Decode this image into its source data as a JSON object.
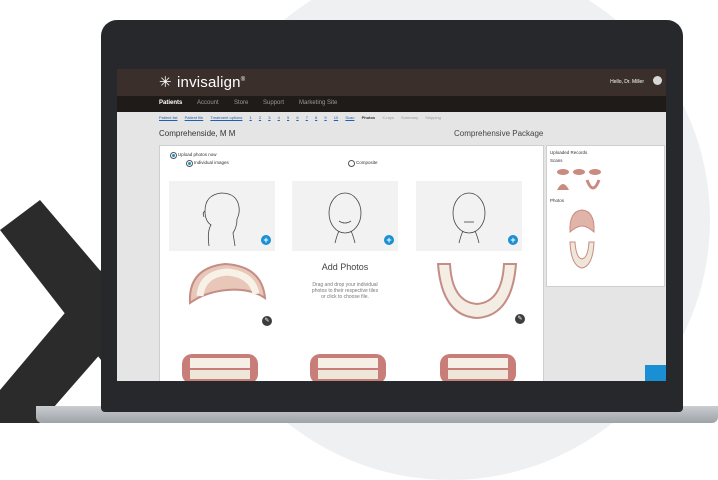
{
  "brand": {
    "name": "invisalign",
    "mark": "®",
    "icon": "sparkle-icon"
  },
  "greeting": "Hello, Dr. Miller",
  "nav": [
    "Patients",
    "Account",
    "Store",
    "Support",
    "Marketing Site"
  ],
  "breadcrumb": {
    "links": [
      "Patient list",
      "Patient file",
      "Treatment options",
      "1",
      "2",
      "3",
      "4",
      "5",
      "6",
      "7",
      "8",
      "9",
      "10",
      "Scan"
    ],
    "current": "Photos",
    "upcoming": [
      "X-rays",
      "Summary",
      "Shipping"
    ]
  },
  "patient_name": "Comprehenside, M M",
  "package": "Comprehensive Package",
  "upload": {
    "option_label": "Upload photos now",
    "individual_label": "Individual images",
    "composite_label": "Composite"
  },
  "dropzone": {
    "title": "Add Photos",
    "description_1": "Drag and drop your individual",
    "description_2": "photos to their respective tiles",
    "description_3": "or click to choose file."
  },
  "records": {
    "title": "Uploaded Records",
    "scans_label": "Scans",
    "photos_label": "Photos"
  },
  "colors": {
    "accent": "#1a8fd3",
    "topbar": "#3a2f2b",
    "nav": "#1f1b19",
    "nav_active": "#d9a04b"
  }
}
